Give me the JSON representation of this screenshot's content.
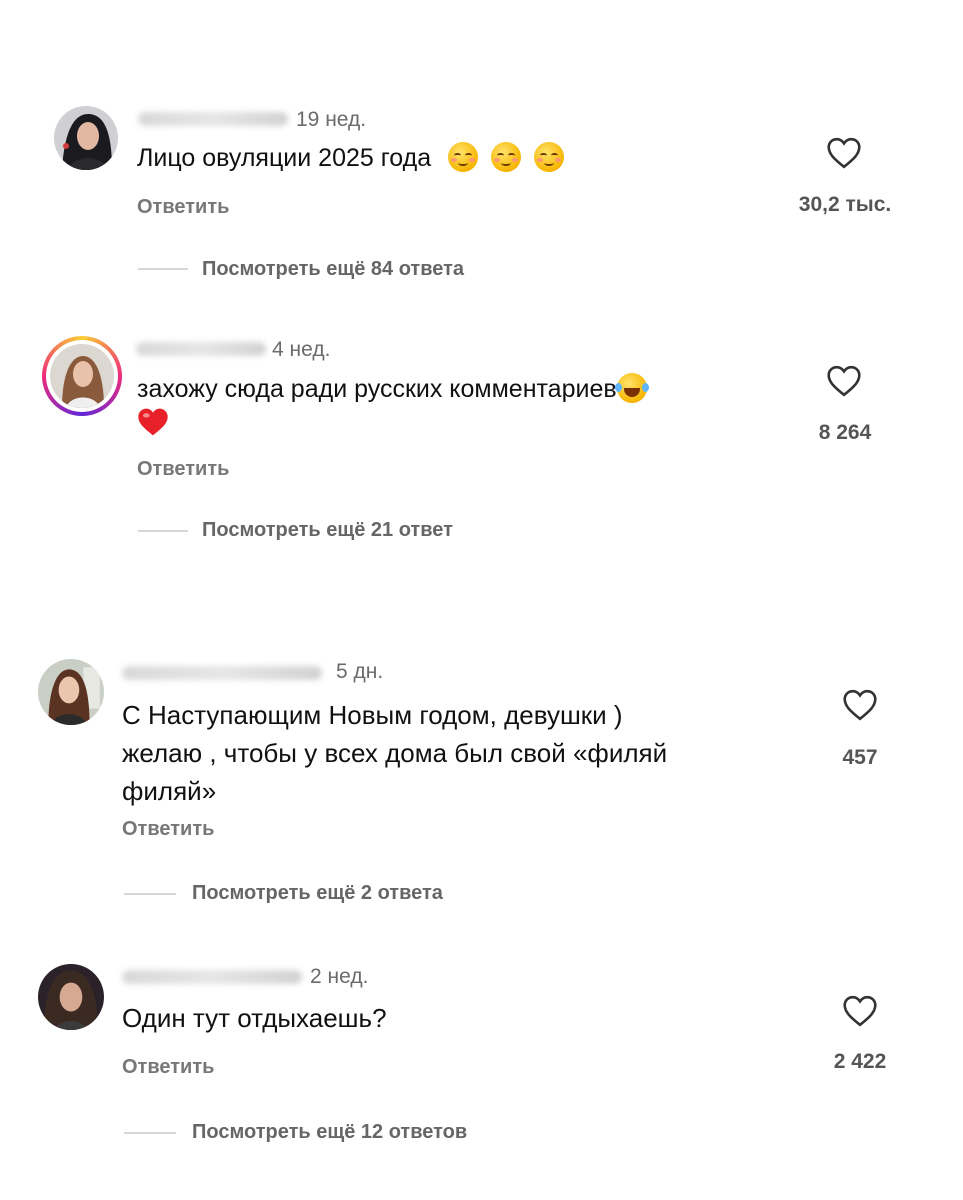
{
  "comments": [
    {
      "time": "19 нед.",
      "text_lines": [
        "Лицо овуляции 2025 года"
      ],
      "reply_label": "Ответить",
      "likes": "30,2 тыс.",
      "more_replies": "Посмотреть ещё 84 ответа",
      "emoji_icons": [
        "relieved-face-emoji",
        "relieved-face-emoji",
        "relieved-face-emoji"
      ]
    },
    {
      "time": "4 нед.",
      "text_lines": [
        "захожу сюда ради русских комментариев"
      ],
      "reply_label": "Ответить",
      "likes": "8 264",
      "more_replies": "Посмотреть ещё 21 ответ",
      "emoji_icons": [
        "tears-of-joy-emoji",
        "red-heart-emoji"
      ],
      "avatar_story_ring": true
    },
    {
      "time": "5 дн.",
      "text_lines": [
        "С Наступающим Новым годом, девушки )",
        "желаю , чтобы у всех дома был свой «филяй",
        "филяй»"
      ],
      "reply_label": "Ответить",
      "likes": "457",
      "more_replies": "Посмотреть ещё 2 ответа"
    },
    {
      "time": "2 нед.",
      "text_lines": [
        "Один тут отдыхаешь?"
      ],
      "reply_label": "Ответить",
      "likes": "2 422",
      "more_replies": "Посмотреть ещё 12 ответов"
    }
  ],
  "icons": {
    "like": "heart-outline-icon",
    "avatar": "avatar"
  },
  "colors": {
    "text": "#111111",
    "secondary": "#6b6b6b",
    "story_ring": "#ee2a7b"
  }
}
